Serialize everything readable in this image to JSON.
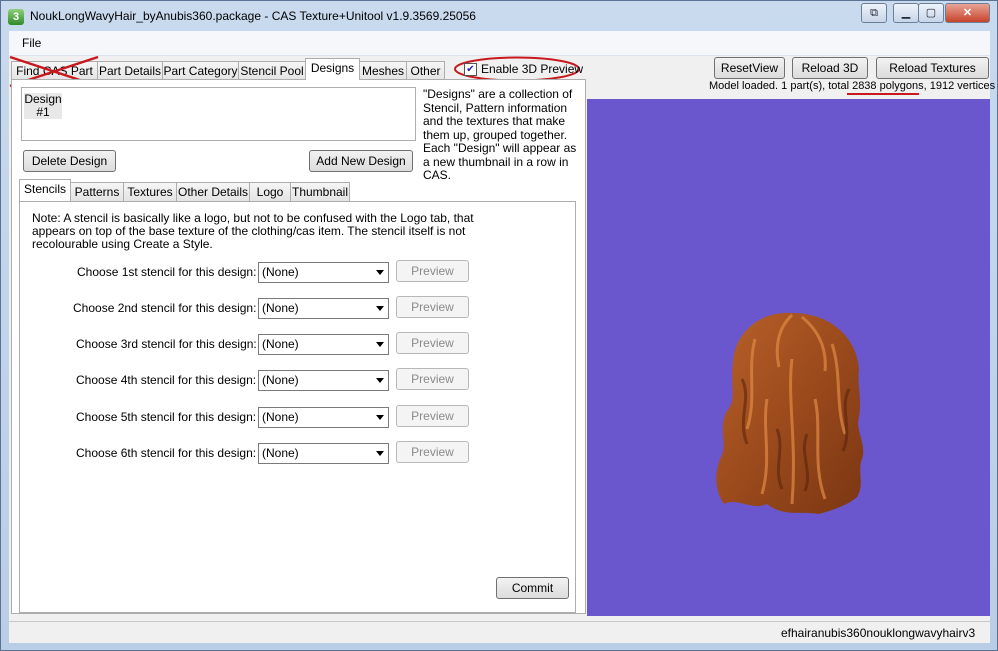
{
  "window": {
    "title": "NoukLongWavyHair_byAnubis360.package - CAS Texture+Unitool v1.9.3569.25056",
    "app_icon": "3",
    "controls": [
      "restore-down-icon",
      "minimize-icon",
      "maximize-icon",
      "close-icon"
    ]
  },
  "menu": {
    "file": "File"
  },
  "top_tabs": [
    "Find CAS Part",
    "Part Details",
    "Part Category",
    "Stencil Pool",
    "Designs",
    "Meshes",
    "Other"
  ],
  "preview_toggle": {
    "label": "Enable 3D Preview",
    "checked": true
  },
  "viewer": {
    "reset_view": "ResetView",
    "reload_3d": "Reload 3D",
    "reload_textures": "Reload Textures",
    "model_info": "Model loaded. 1 part(s), total 2838 polygons, 1912 vertices",
    "background_color": "#6a57cd"
  },
  "designs": {
    "list_header": "Design",
    "list_items": [
      "#1"
    ],
    "description": "\"Designs\" are a collection of Stencil, Pattern information and the textures that make them up, grouped together.  Each \"Design\" will appear as a new thumbnail in a row in CAS.",
    "delete_label": "Delete Design",
    "add_label": "Add New Design"
  },
  "inner_tabs": [
    "Stencils",
    "Patterns",
    "Textures",
    "Other Details",
    "Logo",
    "Thumbnail"
  ],
  "stencils": {
    "note": "Note: A stencil is basically like a logo, but not to be confused with the Logo tab, that appears on top of the base texture of the clothing/cas item.  The stencil itself is not recolourable using Create a Style.",
    "rows": [
      {
        "label": "Choose 1st stencil for this design:",
        "value": "(None)",
        "preview": "Preview"
      },
      {
        "label": "Choose 2nd stencil for this design:",
        "value": "(None)",
        "preview": "Preview"
      },
      {
        "label": "Choose 3rd stencil for this design:",
        "value": "(None)",
        "preview": "Preview"
      },
      {
        "label": "Choose 4th stencil for this design:",
        "value": "(None)",
        "preview": "Preview"
      },
      {
        "label": "Choose 5th stencil for this design:",
        "value": "(None)",
        "preview": "Preview"
      },
      {
        "label": "Choose 6th stencil for this design:",
        "value": "(None)",
        "preview": "Preview"
      }
    ],
    "commit_label": "Commit"
  },
  "status": {
    "text": "efhairanubis360nouklongwavyhairv3"
  },
  "annotation_color": "#c8191e"
}
